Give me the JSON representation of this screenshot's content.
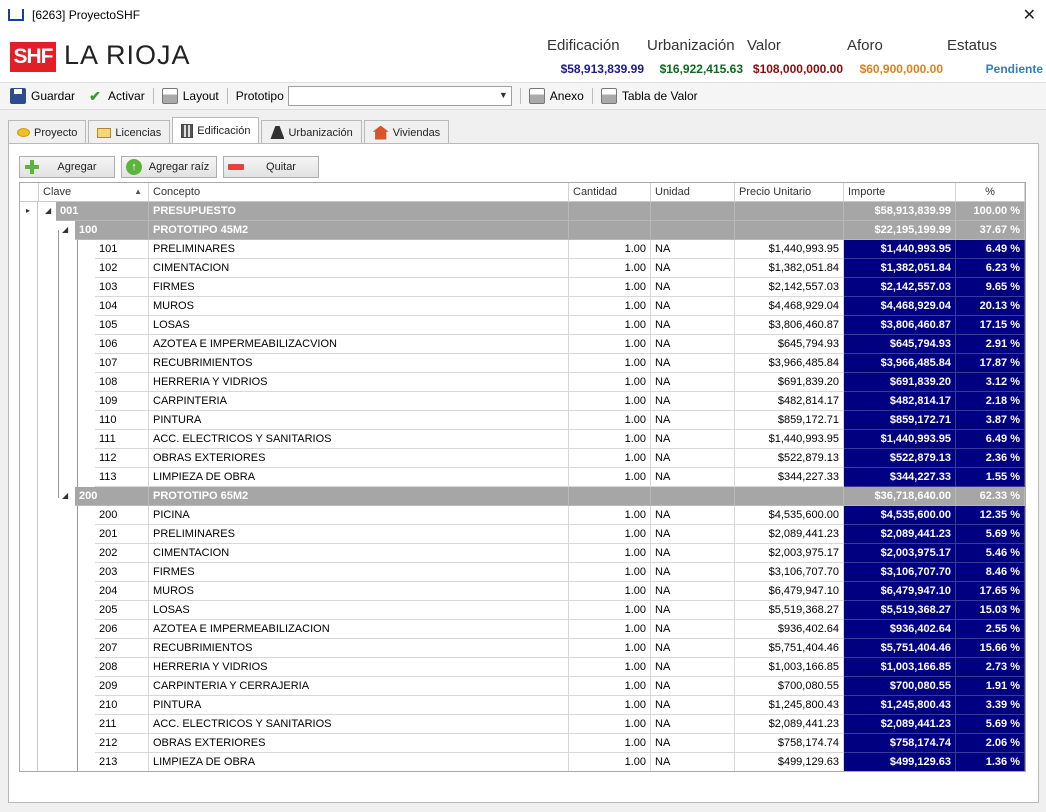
{
  "window": {
    "title": "[6263] ProyectoSHF",
    "close_glyph": "✕"
  },
  "header": {
    "logo": "SHF",
    "project_name": "LA RIOJA",
    "metrics": [
      {
        "label": "Edificación",
        "value": "$58,913,839.99",
        "color": "#1a1a8c"
      },
      {
        "label": "Urbanización",
        "value": "$16,922,415.63",
        "color": "#0a6b1e"
      },
      {
        "label": "Valor",
        "value": "$108,000,000.00",
        "color": "#8b0a0a"
      },
      {
        "label": "Aforo",
        "value": "$60,900,000.00",
        "color": "#e0801a"
      },
      {
        "label": "Estatus",
        "value": "Pendiente",
        "color": "#2f7fc1"
      }
    ]
  },
  "toolbar": {
    "save": "Guardar",
    "activate": "Activar",
    "layout": "Layout",
    "prototype_label": "Prototipo",
    "prototype_value": "",
    "annex": "Anexo",
    "value_table": "Tabla de Valor"
  },
  "tabs": [
    {
      "label": "Proyecto",
      "icon": "coin-icon",
      "active": false
    },
    {
      "label": "Licencias",
      "icon": "license-icon",
      "active": false
    },
    {
      "label": "Edificación",
      "icon": "building-icon",
      "active": true
    },
    {
      "label": "Urbanización",
      "icon": "road-icon",
      "active": false
    },
    {
      "label": "Viviendas",
      "icon": "house-icon",
      "active": false
    }
  ],
  "actions": {
    "add": "Agregar",
    "add_root": "Agregar raíz",
    "remove": "Quitar"
  },
  "grid": {
    "columns": [
      "Clave",
      "Concepto",
      "Cantidad",
      "Unidad",
      "Precio Unitario",
      "Importe",
      "%"
    ],
    "rows": [
      {
        "level": 0,
        "type": "group",
        "clave": "001",
        "concepto": "PRESUPUESTO",
        "cantidad": "",
        "unidad": "",
        "precio": "",
        "importe": "$58,913,839.99",
        "pct": "100.00 %"
      },
      {
        "level": 1,
        "type": "group",
        "clave": "100",
        "concepto": "PROTOTIPO 45M2",
        "cantidad": "",
        "unidad": "",
        "precio": "",
        "importe": "$22,195,199.99",
        "pct": "37.67 %"
      },
      {
        "level": 2,
        "type": "item",
        "clave": "101",
        "concepto": "PRELIMINARES",
        "cantidad": "1.00",
        "unidad": "NA",
        "precio": "$1,440,993.95",
        "importe": "$1,440,993.95",
        "pct": "6.49 %"
      },
      {
        "level": 2,
        "type": "item",
        "clave": "102",
        "concepto": "CIMENTACION",
        "cantidad": "1.00",
        "unidad": "NA",
        "precio": "$1,382,051.84",
        "importe": "$1,382,051.84",
        "pct": "6.23 %"
      },
      {
        "level": 2,
        "type": "item",
        "clave": "103",
        "concepto": "FIRMES",
        "cantidad": "1.00",
        "unidad": "NA",
        "precio": "$2,142,557.03",
        "importe": "$2,142,557.03",
        "pct": "9.65 %"
      },
      {
        "level": 2,
        "type": "item",
        "clave": "104",
        "concepto": "MUROS",
        "cantidad": "1.00",
        "unidad": "NA",
        "precio": "$4,468,929.04",
        "importe": "$4,468,929.04",
        "pct": "20.13 %"
      },
      {
        "level": 2,
        "type": "item",
        "clave": "105",
        "concepto": "LOSAS",
        "cantidad": "1.00",
        "unidad": "NA",
        "precio": "$3,806,460.87",
        "importe": "$3,806,460.87",
        "pct": "17.15 %"
      },
      {
        "level": 2,
        "type": "item",
        "clave": "106",
        "concepto": "AZOTEA E IMPERMEABILIZACVION",
        "cantidad": "1.00",
        "unidad": "NA",
        "precio": "$645,794.93",
        "importe": "$645,794.93",
        "pct": "2.91 %"
      },
      {
        "level": 2,
        "type": "item",
        "clave": "107",
        "concepto": "RECUBRIMIENTOS",
        "cantidad": "1.00",
        "unidad": "NA",
        "precio": "$3,966,485.84",
        "importe": "$3,966,485.84",
        "pct": "17.87 %"
      },
      {
        "level": 2,
        "type": "item",
        "clave": "108",
        "concepto": "HERRERIA Y VIDRIOS",
        "cantidad": "1.00",
        "unidad": "NA",
        "precio": "$691,839.20",
        "importe": "$691,839.20",
        "pct": "3.12 %"
      },
      {
        "level": 2,
        "type": "item",
        "clave": "109",
        "concepto": "CARPINTERIA",
        "cantidad": "1.00",
        "unidad": "NA",
        "precio": "$482,814.17",
        "importe": "$482,814.17",
        "pct": "2.18 %"
      },
      {
        "level": 2,
        "type": "item",
        "clave": "110",
        "concepto": "PINTURA",
        "cantidad": "1.00",
        "unidad": "NA",
        "precio": "$859,172.71",
        "importe": "$859,172.71",
        "pct": "3.87 %"
      },
      {
        "level": 2,
        "type": "item",
        "clave": "111",
        "concepto": "ACC. ELECTRICOS Y SANITARIOS",
        "cantidad": "1.00",
        "unidad": "NA",
        "precio": "$1,440,993.95",
        "importe": "$1,440,993.95",
        "pct": "6.49 %"
      },
      {
        "level": 2,
        "type": "item",
        "clave": "112",
        "concepto": "OBRAS EXTERIORES",
        "cantidad": "1.00",
        "unidad": "NA",
        "precio": "$522,879.13",
        "importe": "$522,879.13",
        "pct": "2.36 %"
      },
      {
        "level": 2,
        "type": "item",
        "clave": "113",
        "concepto": "LIMPIEZA DE OBRA",
        "cantidad": "1.00",
        "unidad": "NA",
        "precio": "$344,227.33",
        "importe": "$344,227.33",
        "pct": "1.55 %"
      },
      {
        "level": 1,
        "type": "group",
        "clave": "200",
        "concepto": "PROTOTIPO 65M2",
        "cantidad": "",
        "unidad": "",
        "precio": "",
        "importe": "$36,718,640.00",
        "pct": "62.33 %"
      },
      {
        "level": 2,
        "type": "item",
        "clave": "200",
        "concepto": "PICINA",
        "cantidad": "1.00",
        "unidad": "NA",
        "precio": "$4,535,600.00",
        "importe": "$4,535,600.00",
        "pct": "12.35 %"
      },
      {
        "level": 2,
        "type": "item",
        "clave": "201",
        "concepto": "PRELIMINARES",
        "cantidad": "1.00",
        "unidad": "NA",
        "precio": "$2,089,441.23",
        "importe": "$2,089,441.23",
        "pct": "5.69 %"
      },
      {
        "level": 2,
        "type": "item",
        "clave": "202",
        "concepto": "CIMENTACION",
        "cantidad": "1.00",
        "unidad": "NA",
        "precio": "$2,003,975.17",
        "importe": "$2,003,975.17",
        "pct": "5.46 %"
      },
      {
        "level": 2,
        "type": "item",
        "clave": "203",
        "concepto": "FIRMES",
        "cantidad": "1.00",
        "unidad": "NA",
        "precio": "$3,106,707.70",
        "importe": "$3,106,707.70",
        "pct": "8.46 %"
      },
      {
        "level": 2,
        "type": "item",
        "clave": "204",
        "concepto": "MUROS",
        "cantidad": "1.00",
        "unidad": "NA",
        "precio": "$6,479,947.10",
        "importe": "$6,479,947.10",
        "pct": "17.65 %"
      },
      {
        "level": 2,
        "type": "item",
        "clave": "205",
        "concepto": "LOSAS",
        "cantidad": "1.00",
        "unidad": "NA",
        "precio": "$5,519,368.27",
        "importe": "$5,519,368.27",
        "pct": "15.03 %"
      },
      {
        "level": 2,
        "type": "item",
        "clave": "206",
        "concepto": "AZOTEA E IMPERMEABILIZACION",
        "cantidad": "1.00",
        "unidad": "NA",
        "precio": "$936,402.64",
        "importe": "$936,402.64",
        "pct": "2.55 %"
      },
      {
        "level": 2,
        "type": "item",
        "clave": "207",
        "concepto": "RECUBRIMIENTOS",
        "cantidad": "1.00",
        "unidad": "NA",
        "precio": "$5,751,404.46",
        "importe": "$5,751,404.46",
        "pct": "15.66 %"
      },
      {
        "level": 2,
        "type": "item",
        "clave": "208",
        "concepto": "HERRERIA Y VIDRIOS",
        "cantidad": "1.00",
        "unidad": "NA",
        "precio": "$1,003,166.85",
        "importe": "$1,003,166.85",
        "pct": "2.73 %"
      },
      {
        "level": 2,
        "type": "item",
        "clave": "209",
        "concepto": "CARPINTERIA Y CERRAJERIA",
        "cantidad": "1.00",
        "unidad": "NA",
        "precio": "$700,080.55",
        "importe": "$700,080.55",
        "pct": "1.91 %"
      },
      {
        "level": 2,
        "type": "item",
        "clave": "210",
        "concepto": "PINTURA",
        "cantidad": "1.00",
        "unidad": "NA",
        "precio": "$1,245,800.43",
        "importe": "$1,245,800.43",
        "pct": "3.39 %"
      },
      {
        "level": 2,
        "type": "item",
        "clave": "211",
        "concepto": "ACC. ELECTRICOS Y SANITARIOS",
        "cantidad": "1.00",
        "unidad": "NA",
        "precio": "$2,089,441.23",
        "importe": "$2,089,441.23",
        "pct": "5.69 %"
      },
      {
        "level": 2,
        "type": "item",
        "clave": "212",
        "concepto": "OBRAS EXTERIORES",
        "cantidad": "1.00",
        "unidad": "NA",
        "precio": "$758,174.74",
        "importe": "$758,174.74",
        "pct": "2.06 %"
      },
      {
        "level": 2,
        "type": "item",
        "clave": "213",
        "concepto": "LIMPIEZA DE OBRA",
        "cantidad": "1.00",
        "unidad": "NA",
        "precio": "$499,129.63",
        "importe": "$499,129.63",
        "pct": "1.36 %"
      }
    ]
  }
}
